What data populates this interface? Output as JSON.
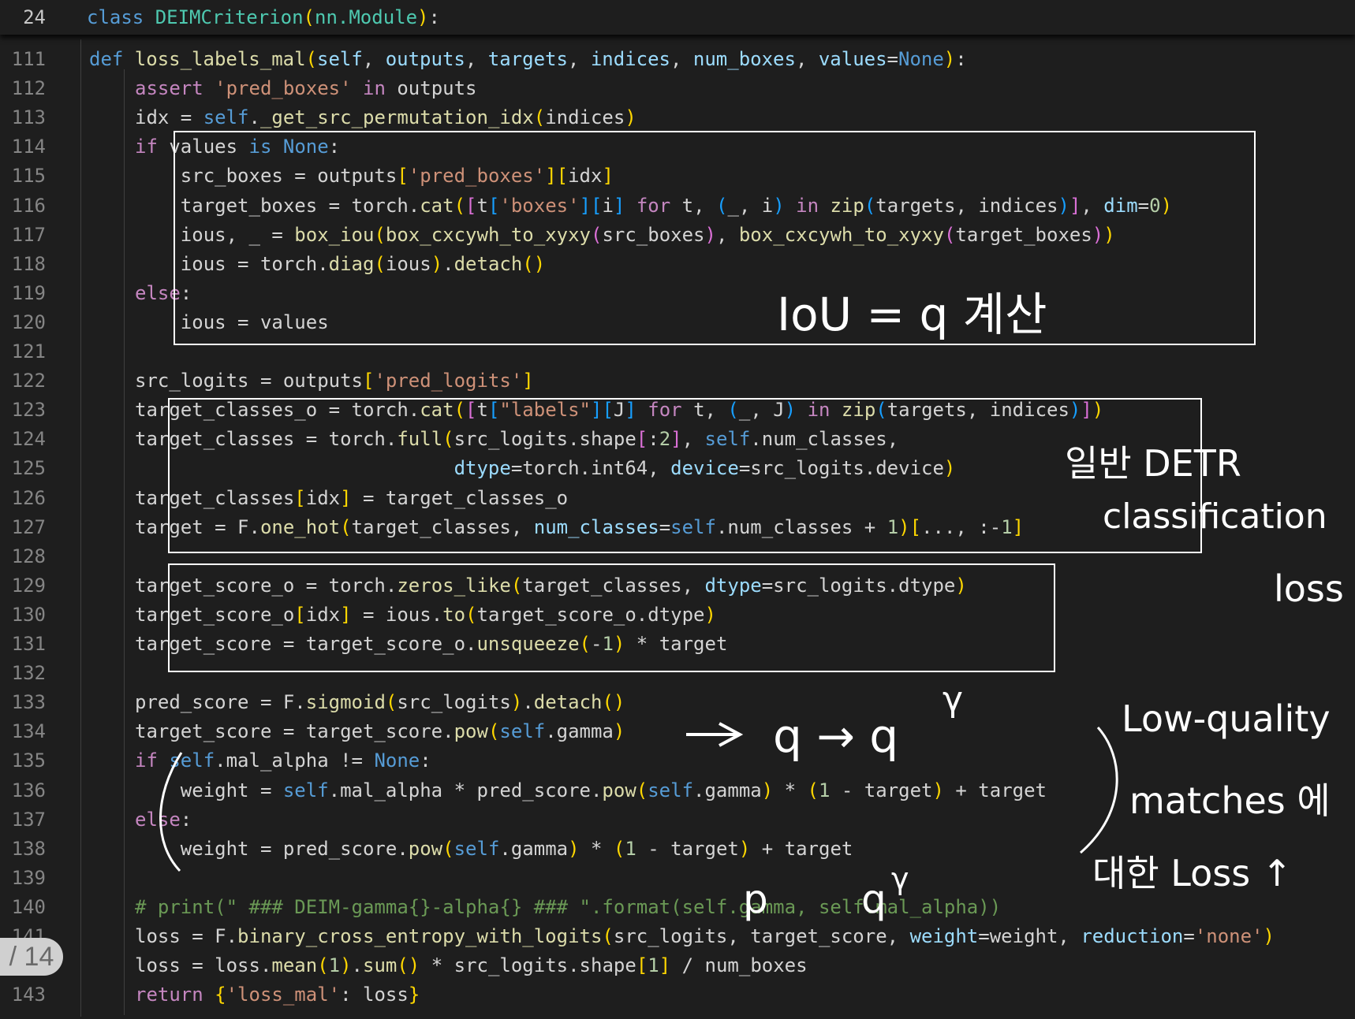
{
  "sticky": {
    "line_number": "24",
    "kw": "class",
    "class_name": "DEIMCriterion",
    "base": "nn.Module"
  },
  "lines": [
    {
      "n": "111",
      "tokens": [
        [
          "kw",
          "def "
        ],
        [
          "fn",
          "loss_labels_mal"
        ],
        [
          "pn",
          "("
        ],
        [
          "var",
          "self"
        ],
        [
          "op",
          ", "
        ],
        [
          "var",
          "outputs"
        ],
        [
          "op",
          ", "
        ],
        [
          "var",
          "targets"
        ],
        [
          "op",
          ", "
        ],
        [
          "var",
          "indices"
        ],
        [
          "op",
          ", "
        ],
        [
          "var",
          "num_boxes"
        ],
        [
          "op",
          ", "
        ],
        [
          "var",
          "values"
        ],
        [
          "op",
          "="
        ],
        [
          "kw",
          "None"
        ],
        [
          "pn",
          ")"
        ],
        [
          "op",
          ":"
        ]
      ]
    },
    {
      "n": "112",
      "tokens": [
        [
          "ctl",
          "assert "
        ],
        [
          "str",
          "'pred_boxes'"
        ],
        [
          "ctl",
          " in "
        ],
        [
          "op",
          "outputs"
        ]
      ]
    },
    {
      "n": "113",
      "tokens": [
        [
          "op",
          "idx = "
        ],
        [
          "kw",
          "self"
        ],
        [
          "op",
          "."
        ],
        [
          "fn",
          "_get_src_permutation_idx"
        ],
        [
          "pn",
          "("
        ],
        [
          "op",
          "indices"
        ],
        [
          "pn",
          ")"
        ]
      ]
    },
    {
      "n": "114",
      "tokens": [
        [
          "ctl",
          "if "
        ],
        [
          "op",
          "values "
        ],
        [
          "kw",
          "is "
        ],
        [
          "kw",
          "None"
        ],
        [
          "op",
          ":"
        ]
      ]
    },
    {
      "n": "115",
      "tokens": [
        [
          "op",
          "    src_boxes = outputs"
        ],
        [
          "pn",
          "["
        ],
        [
          "str",
          "'pred_boxes'"
        ],
        [
          "pn",
          "]"
        ],
        [
          "pn",
          "["
        ],
        [
          "op",
          "idx"
        ],
        [
          "pn",
          "]"
        ]
      ]
    },
    {
      "n": "116",
      "tokens": [
        [
          "op",
          "    target_boxes = torch."
        ],
        [
          "fn",
          "cat"
        ],
        [
          "pn",
          "("
        ],
        [
          "pn2",
          "["
        ],
        [
          "op",
          "t"
        ],
        [
          "pn3",
          "["
        ],
        [
          "str",
          "'boxes'"
        ],
        [
          "pn3",
          "]"
        ],
        [
          "pn3",
          "["
        ],
        [
          "op",
          "i"
        ],
        [
          "pn3",
          "]"
        ],
        [
          "ctl",
          " for "
        ],
        [
          "op",
          "t, "
        ],
        [
          "pn3",
          "("
        ],
        [
          "op",
          "_, i"
        ],
        [
          "pn3",
          ")"
        ],
        [
          "ctl",
          " in "
        ],
        [
          "fn",
          "zip"
        ],
        [
          "pn3",
          "("
        ],
        [
          "op",
          "targets, indices"
        ],
        [
          "pn3",
          ")"
        ],
        [
          "pn2",
          "]"
        ],
        [
          "op",
          ", "
        ],
        [
          "var",
          "dim"
        ],
        [
          "op",
          "="
        ],
        [
          "num",
          "0"
        ],
        [
          "pn",
          ")"
        ]
      ]
    },
    {
      "n": "117",
      "tokens": [
        [
          "op",
          "    ious, _ = "
        ],
        [
          "fn",
          "box_iou"
        ],
        [
          "pn",
          "("
        ],
        [
          "fn",
          "box_cxcywh_to_xyxy"
        ],
        [
          "pn2",
          "("
        ],
        [
          "op",
          "src_boxes"
        ],
        [
          "pn2",
          ")"
        ],
        [
          "op",
          ", "
        ],
        [
          "fn",
          "box_cxcywh_to_xyxy"
        ],
        [
          "pn2",
          "("
        ],
        [
          "op",
          "target_boxes"
        ],
        [
          "pn2",
          ")"
        ],
        [
          "pn",
          ")"
        ]
      ]
    },
    {
      "n": "118",
      "tokens": [
        [
          "op",
          "    ious = torch."
        ],
        [
          "fn",
          "diag"
        ],
        [
          "pn",
          "("
        ],
        [
          "op",
          "ious"
        ],
        [
          "pn",
          ")"
        ],
        [
          "op",
          "."
        ],
        [
          "fn",
          "detach"
        ],
        [
          "pn",
          "()"
        ]
      ]
    },
    {
      "n": "119",
      "tokens": [
        [
          "ctl",
          "else"
        ],
        [
          "op",
          ":"
        ]
      ]
    },
    {
      "n": "120",
      "tokens": [
        [
          "op",
          "    ious = values"
        ]
      ]
    },
    {
      "n": "121",
      "tokens": []
    },
    {
      "n": "122",
      "tokens": [
        [
          "op",
          "src_logits = outputs"
        ],
        [
          "pn",
          "["
        ],
        [
          "str",
          "'pred_logits'"
        ],
        [
          "pn",
          "]"
        ]
      ]
    },
    {
      "n": "123",
      "tokens": [
        [
          "op",
          "target_classes_o = torch."
        ],
        [
          "fn",
          "cat"
        ],
        [
          "pn",
          "("
        ],
        [
          "pn2",
          "["
        ],
        [
          "op",
          "t"
        ],
        [
          "pn3",
          "["
        ],
        [
          "str",
          "\"labels\""
        ],
        [
          "pn3",
          "]"
        ],
        [
          "pn3",
          "["
        ],
        [
          "op",
          "J"
        ],
        [
          "pn3",
          "]"
        ],
        [
          "ctl",
          " for "
        ],
        [
          "op",
          "t, "
        ],
        [
          "pn3",
          "("
        ],
        [
          "op",
          "_, J"
        ],
        [
          "pn3",
          ")"
        ],
        [
          "ctl",
          " in "
        ],
        [
          "fn",
          "zip"
        ],
        [
          "pn3",
          "("
        ],
        [
          "op",
          "targets, indices"
        ],
        [
          "pn3",
          ")"
        ],
        [
          "pn2",
          "]"
        ],
        [
          "pn",
          ")"
        ]
      ]
    },
    {
      "n": "124",
      "tokens": [
        [
          "op",
          "target_classes = torch."
        ],
        [
          "fn",
          "full"
        ],
        [
          "pn",
          "("
        ],
        [
          "op",
          "src_logits.shape"
        ],
        [
          "pn2",
          "["
        ],
        [
          "op",
          ":"
        ],
        [
          "num",
          "2"
        ],
        [
          "pn2",
          "]"
        ],
        [
          "op",
          ", "
        ],
        [
          "kw",
          "self"
        ],
        [
          "op",
          ".num_classes,"
        ]
      ]
    },
    {
      "n": "125",
      "tokens": [
        [
          "op",
          "                            "
        ],
        [
          "var",
          "dtype"
        ],
        [
          "op",
          "=torch.int64, "
        ],
        [
          "var",
          "device"
        ],
        [
          "op",
          "=src_logits.device"
        ],
        [
          "pn",
          ")"
        ]
      ]
    },
    {
      "n": "126",
      "tokens": [
        [
          "op",
          "target_classes"
        ],
        [
          "pn",
          "["
        ],
        [
          "op",
          "idx"
        ],
        [
          "pn",
          "]"
        ],
        [
          "op",
          " = target_classes_o"
        ]
      ]
    },
    {
      "n": "127",
      "tokens": [
        [
          "op",
          "target = F."
        ],
        [
          "fn",
          "one_hot"
        ],
        [
          "pn",
          "("
        ],
        [
          "op",
          "target_classes, "
        ],
        [
          "var",
          "num_classes"
        ],
        [
          "op",
          "="
        ],
        [
          "kw",
          "self"
        ],
        [
          "op",
          ".num_classes + "
        ],
        [
          "num",
          "1"
        ],
        [
          "pn",
          ")"
        ],
        [
          "pn",
          "["
        ],
        [
          "op",
          "..., :-"
        ],
        [
          "num",
          "1"
        ],
        [
          "pn",
          "]"
        ]
      ]
    },
    {
      "n": "128",
      "tokens": []
    },
    {
      "n": "129",
      "tokens": [
        [
          "op",
          "target_score_o = torch."
        ],
        [
          "fn",
          "zeros_like"
        ],
        [
          "pn",
          "("
        ],
        [
          "op",
          "target_classes, "
        ],
        [
          "var",
          "dtype"
        ],
        [
          "op",
          "=src_logits.dtype"
        ],
        [
          "pn",
          ")"
        ]
      ]
    },
    {
      "n": "130",
      "tokens": [
        [
          "op",
          "target_score_o"
        ],
        [
          "pn",
          "["
        ],
        [
          "op",
          "idx"
        ],
        [
          "pn",
          "]"
        ],
        [
          "op",
          " = ious."
        ],
        [
          "fn",
          "to"
        ],
        [
          "pn",
          "("
        ],
        [
          "op",
          "target_score_o.dtype"
        ],
        [
          "pn",
          ")"
        ]
      ]
    },
    {
      "n": "131",
      "tokens": [
        [
          "op",
          "target_score = target_score_o."
        ],
        [
          "fn",
          "unsqueeze"
        ],
        [
          "pn",
          "("
        ],
        [
          "op",
          "-"
        ],
        [
          "num",
          "1"
        ],
        [
          "pn",
          ")"
        ],
        [
          "op",
          " * target"
        ]
      ]
    },
    {
      "n": "132",
      "tokens": []
    },
    {
      "n": "133",
      "tokens": [
        [
          "op",
          "pred_score = F."
        ],
        [
          "fn",
          "sigmoid"
        ],
        [
          "pn",
          "("
        ],
        [
          "op",
          "src_logits"
        ],
        [
          "pn",
          ")"
        ],
        [
          "op",
          "."
        ],
        [
          "fn",
          "detach"
        ],
        [
          "pn",
          "()"
        ]
      ]
    },
    {
      "n": "134",
      "tokens": [
        [
          "op",
          "target_score = target_score."
        ],
        [
          "fn",
          "pow"
        ],
        [
          "pn",
          "("
        ],
        [
          "kw",
          "self"
        ],
        [
          "op",
          ".gamma"
        ],
        [
          "pn",
          ")"
        ]
      ]
    },
    {
      "n": "135",
      "tokens": [
        [
          "ctl",
          "if "
        ],
        [
          "kw",
          "self"
        ],
        [
          "op",
          ".mal_alpha != "
        ],
        [
          "kw",
          "None"
        ],
        [
          "op",
          ":"
        ]
      ]
    },
    {
      "n": "136",
      "tokens": [
        [
          "op",
          "    weight = "
        ],
        [
          "kw",
          "self"
        ],
        [
          "op",
          ".mal_alpha * pred_score."
        ],
        [
          "fn",
          "pow"
        ],
        [
          "pn",
          "("
        ],
        [
          "kw",
          "self"
        ],
        [
          "op",
          ".gamma"
        ],
        [
          "pn",
          ")"
        ],
        [
          "op",
          " * "
        ],
        [
          "pn",
          "("
        ],
        [
          "num",
          "1"
        ],
        [
          "op",
          " - target"
        ],
        [
          "pn",
          ")"
        ],
        [
          "op",
          " + target"
        ]
      ]
    },
    {
      "n": "137",
      "tokens": [
        [
          "ctl",
          "else"
        ],
        [
          "op",
          ":"
        ]
      ]
    },
    {
      "n": "138",
      "tokens": [
        [
          "op",
          "    weight = pred_score."
        ],
        [
          "fn",
          "pow"
        ],
        [
          "pn",
          "("
        ],
        [
          "kw",
          "self"
        ],
        [
          "op",
          ".gamma"
        ],
        [
          "pn",
          ")"
        ],
        [
          "op",
          " * "
        ],
        [
          "pn",
          "("
        ],
        [
          "num",
          "1"
        ],
        [
          "op",
          " - target"
        ],
        [
          "pn",
          ")"
        ],
        [
          "op",
          " + target"
        ]
      ]
    },
    {
      "n": "139",
      "tokens": []
    },
    {
      "n": "140",
      "tokens": [
        [
          "cmt",
          "# print(\" ### DEIM-gamma{}-alpha{} ### \".format(self.gamma, self.mal_alpha))"
        ]
      ]
    },
    {
      "n": "141",
      "tokens": [
        [
          "op",
          "loss = F."
        ],
        [
          "fn",
          "binary_cross_entropy_with_logits"
        ],
        [
          "pn",
          "("
        ],
        [
          "op",
          "src_logits, target_score, "
        ],
        [
          "var",
          "weight"
        ],
        [
          "op",
          "=weight, "
        ],
        [
          "var",
          "reduction"
        ],
        [
          "op",
          "="
        ],
        [
          "str",
          "'none'"
        ],
        [
          "pn",
          ")"
        ]
      ]
    },
    {
      "n": "142",
      "tokens": [
        [
          "op",
          "loss = loss."
        ],
        [
          "fn",
          "mean"
        ],
        [
          "pn",
          "("
        ],
        [
          "num",
          "1"
        ],
        [
          "pn",
          ")"
        ],
        [
          "op",
          "."
        ],
        [
          "fn",
          "sum"
        ],
        [
          "pn",
          "()"
        ],
        [
          "op",
          " * src_logits.shape"
        ],
        [
          "pn",
          "["
        ],
        [
          "num",
          "1"
        ],
        [
          "pn",
          "]"
        ],
        [
          "op",
          " / num_boxes"
        ]
      ]
    },
    {
      "n": "143",
      "tokens": [
        [
          "ctl",
          "return "
        ],
        [
          "pn",
          "{"
        ],
        [
          "str",
          "'loss_mal'"
        ],
        [
          "op",
          ": loss"
        ],
        [
          "pn",
          "}"
        ]
      ]
    }
  ],
  "annotations": {
    "iou": "IoU = q 계산",
    "detr1": "일반 DETR",
    "detr2": "classification",
    "detr3": "loss",
    "power": "q → q",
    "power_sup": "γ",
    "lq1": "Low-quality",
    "lq2": "matches 에",
    "lq3": "대한 Loss ↑",
    "pq": "p",
    "qg": "q",
    "qg_sup": "γ"
  },
  "page_badge": "/ 14"
}
